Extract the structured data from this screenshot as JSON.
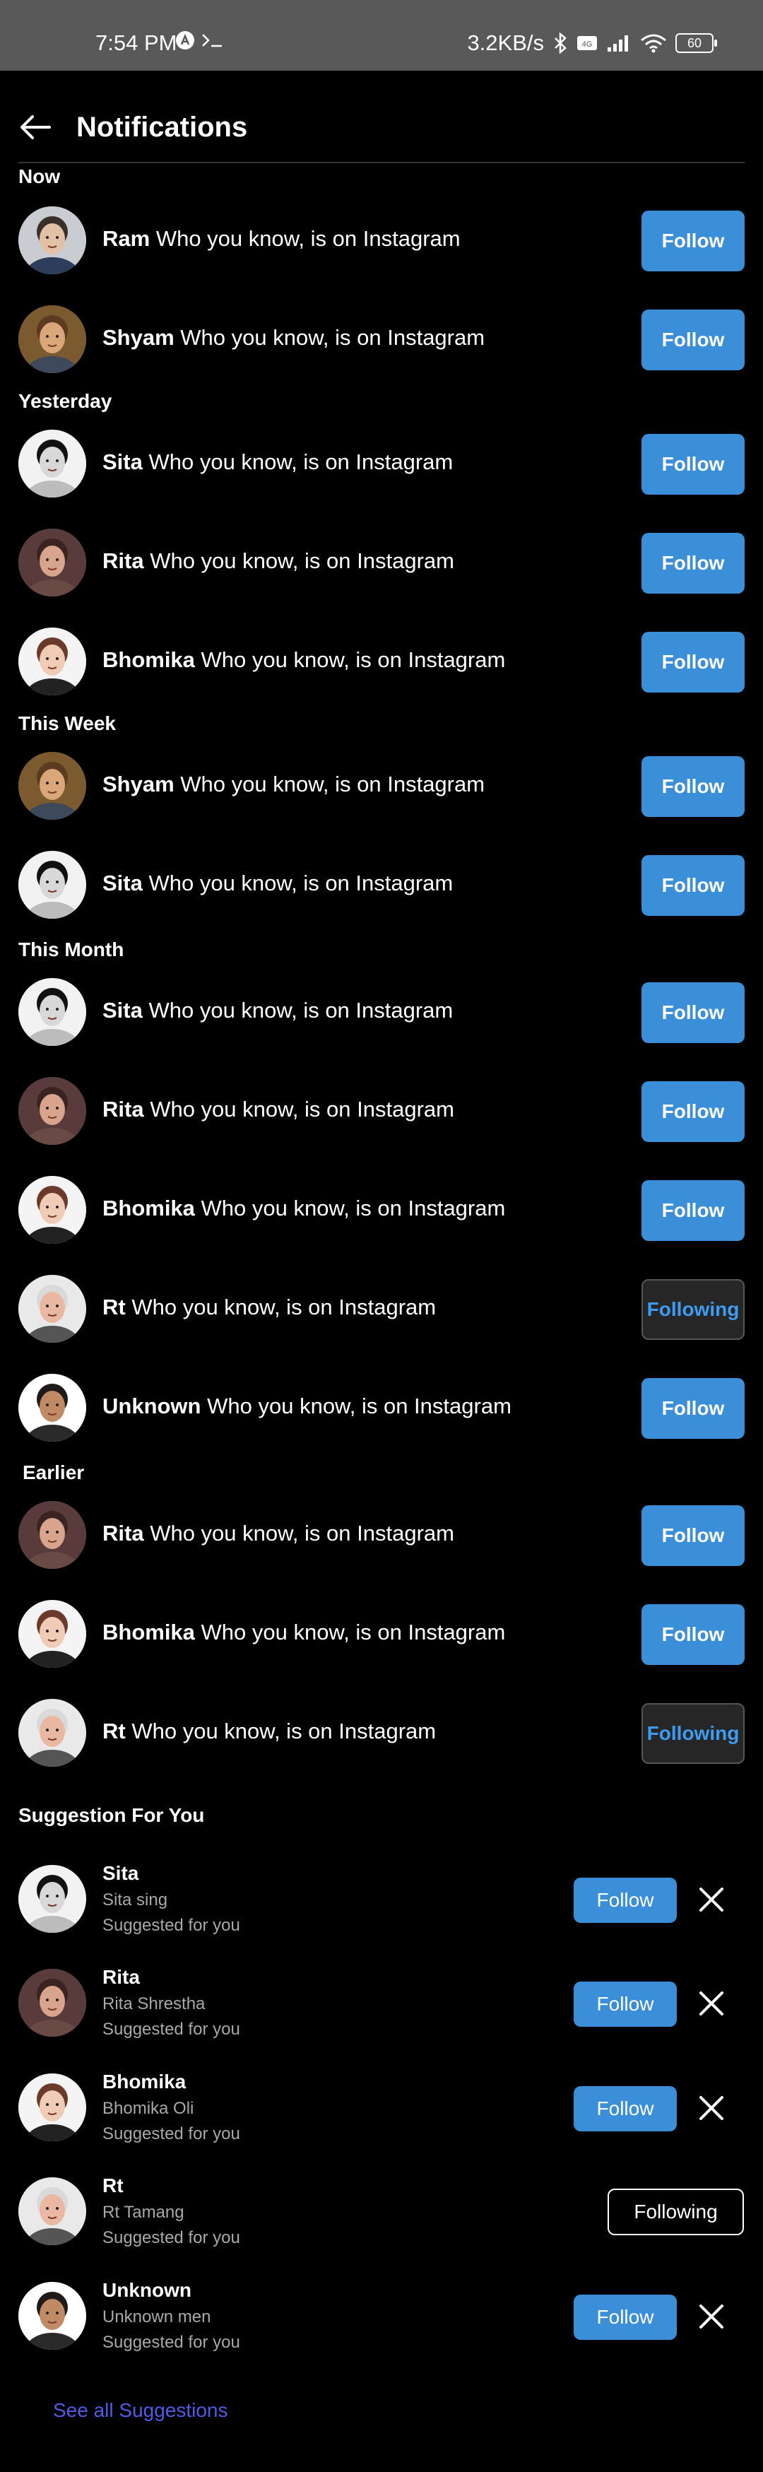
{
  "status_bar": {
    "time": "7:54 PM",
    "network_speed": "3.2KB/s",
    "battery": "60",
    "icons": [
      "a-circle-icon",
      "terminal-icon",
      "bluetooth-icon",
      "volte-icon",
      "signal-icon",
      "wifi-icon",
      "battery-icon"
    ]
  },
  "header": {
    "title": "Notifications",
    "back_icon": "arrow-left-icon"
  },
  "notification_suffix": "Who you know, is on Instagram",
  "sections": [
    {
      "title": "Now",
      "rows": [
        {
          "name": "Ram",
          "button": "Follow"
        },
        {
          "name": "Shyam",
          "button": "Follow"
        }
      ]
    },
    {
      "title": "Yesterday",
      "rows": [
        {
          "name": "Sita",
          "button": "Follow"
        },
        {
          "name": "Rita",
          "button": "Follow"
        },
        {
          "name": "Bhomika",
          "button": "Follow"
        }
      ]
    },
    {
      "title": "This Week",
      "rows": [
        {
          "name": "Shyam",
          "button": "Follow"
        },
        {
          "name": "Sita",
          "button": "Follow"
        }
      ]
    },
    {
      "title": "This Month",
      "rows": [
        {
          "name": "Sita",
          "button": "Follow"
        },
        {
          "name": "Rita",
          "button": "Follow"
        },
        {
          "name": "Bhomika",
          "button": "Follow"
        },
        {
          "name": "Rt",
          "button": "Following"
        },
        {
          "name": "Unknown",
          "button": "Follow"
        }
      ]
    },
    {
      "title": "Earlier",
      "rows": [
        {
          "name": "Rita",
          "button": "Follow"
        },
        {
          "name": "Bhomika",
          "button": "Follow"
        },
        {
          "name": "Rt",
          "button": "Following"
        }
      ]
    }
  ],
  "suggestions": {
    "title": "Suggestion For You",
    "items": [
      {
        "name": "Sita",
        "full_name": "Sita sing",
        "note": "Suggested for you",
        "button": "Follow"
      },
      {
        "name": "Rita",
        "full_name": "Rita Shrestha",
        "note": "Suggested for you",
        "button": "Follow"
      },
      {
        "name": "Bhomika",
        "full_name": "Bhomika Oli",
        "note": "Suggested for you",
        "button": "Follow"
      },
      {
        "name": "Rt",
        "full_name": "Rt Tamang",
        "note": "Suggested for you",
        "button": "Following"
      },
      {
        "name": "Unknown",
        "full_name": "Unknown men",
        "note": "Suggested for you",
        "button": "Follow"
      }
    ],
    "see_all": "See all Suggestions"
  },
  "colors": {
    "background": "#000000",
    "status_bar": "#595959",
    "follow_button": "#3b8ed8",
    "following_text": "#3d9cf2",
    "see_all_link": "#4f5ce6"
  }
}
